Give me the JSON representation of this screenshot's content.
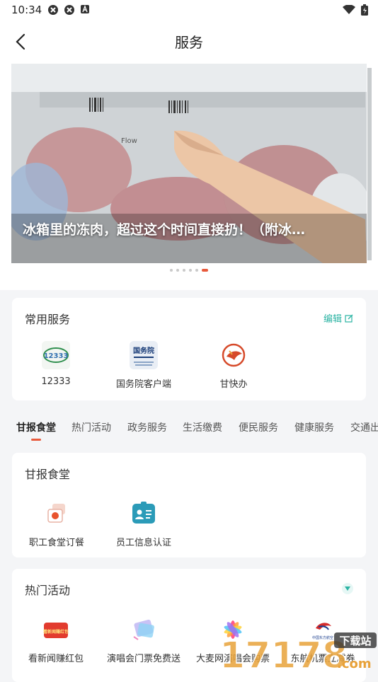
{
  "status": {
    "time": "10:34"
  },
  "header": {
    "title": "服务"
  },
  "banner": {
    "caption": "冰箱里的冻肉，超过这个时间直接扔！（附冰…",
    "dot_count": 6,
    "active_dot": 5,
    "flow_text": "Flow"
  },
  "common_services": {
    "title": "常用服务",
    "edit_label": "编辑",
    "items": [
      {
        "label": "12333",
        "icon": "12333-app-icon",
        "icon_text": "12333"
      },
      {
        "label": "国务院客户端",
        "icon": "state-council-app-icon",
        "icon_text": "国务院"
      },
      {
        "label": "甘快办",
        "icon": "gan-kuai-ban-icon"
      }
    ]
  },
  "tabs": {
    "items": [
      {
        "label": "甘报食堂",
        "active": true
      },
      {
        "label": "热门活动"
      },
      {
        "label": "政务服务"
      },
      {
        "label": "生活缴费"
      },
      {
        "label": "便民服务"
      },
      {
        "label": "健康服务"
      },
      {
        "label": "交通出行"
      }
    ]
  },
  "canteen": {
    "title": "甘报食堂",
    "items": [
      {
        "label": "职工食堂订餐",
        "icon": "meal-order-icon"
      },
      {
        "label": "员工信息认证",
        "icon": "id-card-icon"
      }
    ]
  },
  "hot": {
    "title": "热门活动",
    "items": [
      {
        "label": "看新闻赚红包",
        "icon": "news-red-packet-icon",
        "icon_text": "看新闻赚红包"
      },
      {
        "label": "演唱会门票免费送",
        "icon": "concert-ticket-icon"
      },
      {
        "label": "大麦网演唱会购票",
        "icon": "damai-icon"
      },
      {
        "label": "东航机票立减券",
        "icon": "china-eastern-icon",
        "icon_text": "中国东方航空"
      }
    ]
  },
  "watermark": {
    "text": "17178",
    "sub": "下载站",
    "domain": ".com"
  },
  "colors": {
    "accent": "#e85a3c",
    "teal": "#2bb3a3"
  }
}
